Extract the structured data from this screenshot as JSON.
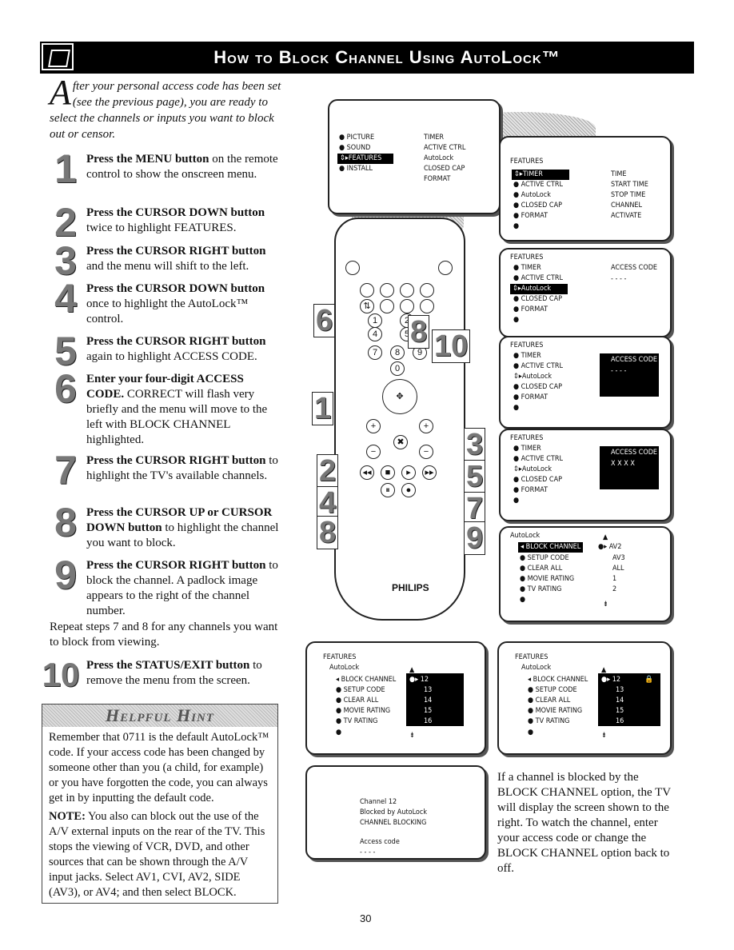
{
  "header": {
    "title": "How to Block Channel Using AutoLock™",
    "icon": "remote-hand-icon"
  },
  "intro": {
    "dropcap": "A",
    "text": "fter your personal access code has been set (see the previous page), you are ready to select the channels or inputs you want to block out or censor."
  },
  "steps": [
    {
      "num": "1",
      "bold": "Press the MENU button",
      "text": " on the remote control to show the onscreen menu."
    },
    {
      "num": "2",
      "bold": "Press the CURSOR DOWN button",
      "text": " twice to highlight FEATURES."
    },
    {
      "num": "3",
      "bold": "Press the CURSOR RIGHT button",
      "text": " and the menu will shift to the left."
    },
    {
      "num": "4",
      "bold": "Press the CURSOR DOWN button",
      "text": " once to highlight the AutoLock™ control."
    },
    {
      "num": "5",
      "bold": "Press the CURSOR RIGHT button",
      "text": " again to highlight ACCESS CODE."
    },
    {
      "num": "6",
      "bold": "Enter your four-digit ACCESS CODE.",
      "text": " CORRECT will flash very briefly and the menu will move to the left with BLOCK CHANNEL highlighted."
    },
    {
      "num": "7",
      "bold": "Press the CURSOR RIGHT button",
      "text": " to highlight the TV's available channels."
    },
    {
      "num": "8",
      "bold": "Press the CURSOR UP or CURSOR DOWN button",
      "text": " to highlight the channel you want to block."
    },
    {
      "num": "9",
      "bold": "Press the CURSOR RIGHT button",
      "text": " to block the channel. A padlock image appears to the right of the channel number."
    },
    {
      "num": "10",
      "bold": "Press the STATUS/EXIT button",
      "text": " to remove the menu from the screen."
    }
  ],
  "repeat_text": "Repeat steps 7 and 8 for any channels you want to block from viewing.",
  "hint": {
    "title": "Helpful Hint",
    "p1": "Remember that 0711 is the default AutoLock™ code. If your access code has been changed by someone other than you (a child, for example) or you have forgotten the code, you can always get in by inputting the default code.",
    "note_label": "NOTE:",
    "p2": " You also can block out the use of the A/V external inputs on the rear of the TV. This stops the viewing of VCR, DVD, and other sources that can be shown through the A/V input jacks. Select AV1, CVI, AV2, SIDE (AV3), or AV4; and then select BLOCK."
  },
  "screens": {
    "main": {
      "left": [
        "PICTURE",
        "SOUND",
        "FEATURES",
        "INSTALL"
      ],
      "right": [
        "TIMER",
        "ACTIVE CTRL",
        "AutoLock",
        "CLOSED CAP",
        "FORMAT"
      ]
    },
    "features_title": "FEATURES",
    "features_items": [
      "TIMER",
      "ACTIVE CTRL",
      "AutoLock",
      "CLOSED CAP",
      "FORMAT"
    ],
    "timer_sub": [
      "TIME",
      "START TIME",
      "STOP TIME",
      "CHANNEL",
      "ACTIVATE"
    ],
    "access_code": "ACCESS CODE",
    "dashes": "- - - -",
    "xs": "X X X X",
    "autolock_title": "AutoLock",
    "autolock_items": [
      "BLOCK CHANNEL",
      "SETUP CODE",
      "CLEAR ALL",
      "MOVIE RATING",
      "TV RATING"
    ],
    "inputs": [
      "AV2",
      "AV3",
      "ALL",
      "1",
      "2"
    ],
    "channels": [
      "12",
      "13",
      "14",
      "15",
      "16"
    ],
    "blocked": {
      "line1": "Channel 12",
      "line2": "Blocked by AutoLock",
      "line3": "CHANNEL BLOCKING",
      "line4": "Access code",
      "line5": "- - - -"
    }
  },
  "remote": {
    "brand": "PHILIPS",
    "step_labels": [
      "6",
      "8",
      "10",
      "1",
      "2",
      "4",
      "8",
      "3",
      "5",
      "7",
      "9"
    ]
  },
  "note": "If a channel is blocked by the BLOCK CHANNEL option, the TV will display the screen shown to the right. To watch the channel, enter your access code or change the BLOCK CHANNEL option back to off.",
  "page_number": "30"
}
